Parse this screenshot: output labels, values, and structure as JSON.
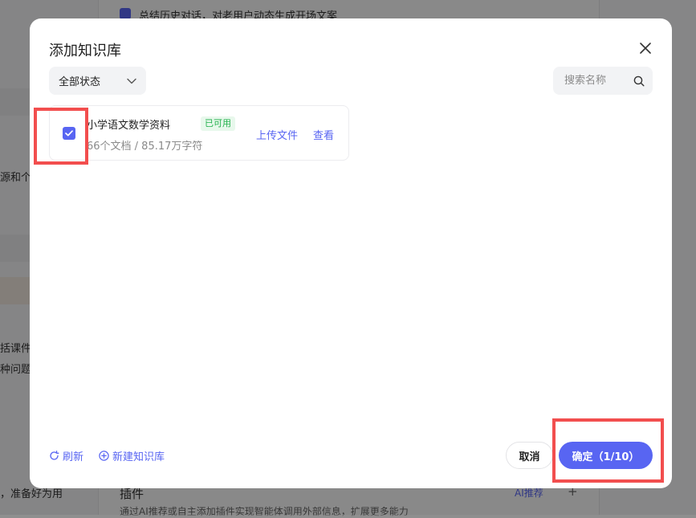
{
  "background": {
    "top_option": "总结历史对话，对老用户动态生成开场文案",
    "left_fragments": [
      "源和个",
      "括课件",
      "种问题",
      "，准备好为用"
    ],
    "plugin_title": "插件",
    "plugin_ai_label": "AI推荐",
    "plugin_add": "+",
    "plugin_desc": "通过AI推荐或自主添加插件实现智能体调用外部信息，扩展更多能力"
  },
  "modal": {
    "title": "添加知识库",
    "status_filter": "全部状态",
    "search_placeholder": "搜索名称",
    "knowledge_bases": [
      {
        "name": "小学语文数学资料",
        "status": "已可用",
        "meta": "66个文档 / 85.17万字符",
        "upload_label": "上传文件",
        "view_label": "查看",
        "checked": true
      }
    ],
    "refresh_label": "刷新",
    "new_kb_label": "新建知识库",
    "cancel_label": "取消",
    "confirm_label": "确定（1/10）"
  },
  "colors": {
    "accent": "#5865f2",
    "status_green": "#22b14c",
    "annotation_red": "#f24e4e"
  }
}
